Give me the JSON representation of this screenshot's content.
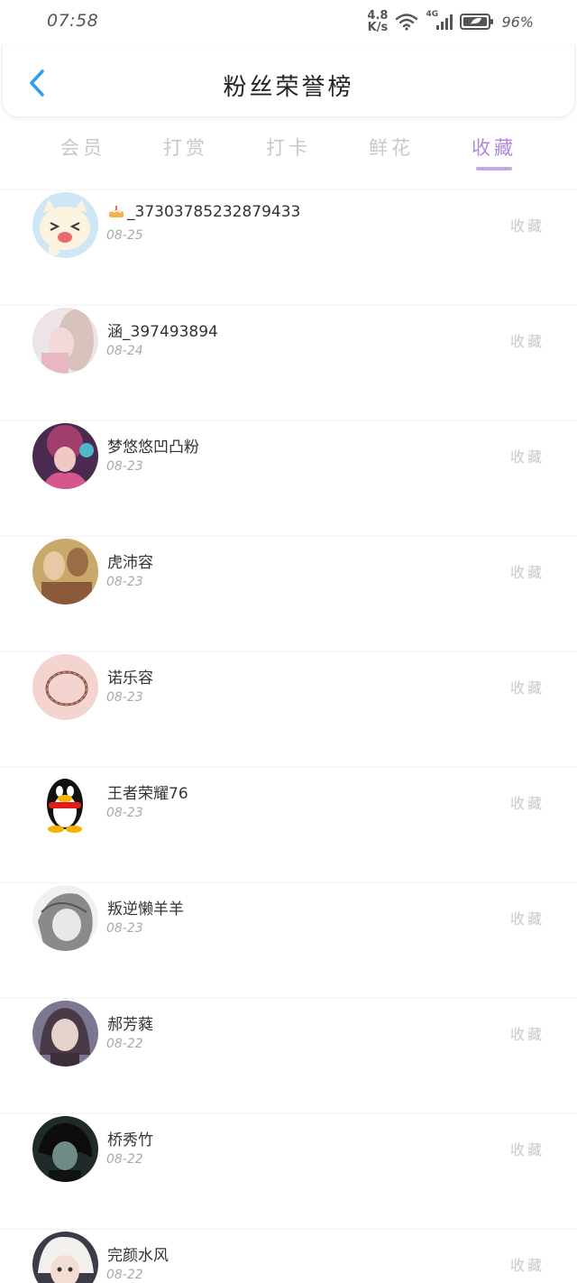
{
  "status": {
    "time": "07:58",
    "net_speed_value": "4.8",
    "net_speed_unit": "K/s",
    "network_type": "4G",
    "battery": "96%"
  },
  "header": {
    "title": "粉丝荣誉榜"
  },
  "tabs": [
    {
      "label": "会员",
      "active": false
    },
    {
      "label": "打赏",
      "active": false
    },
    {
      "label": "打卡",
      "active": false
    },
    {
      "label": "鲜花",
      "active": false
    },
    {
      "label": "收藏",
      "active": true
    }
  ],
  "colors": {
    "accent": "#b08ad8",
    "back_arrow": "#2ea0f0",
    "inactive_tab": "#c8c8c8",
    "muted_text": "#a9a9a9"
  },
  "fans": [
    {
      "name": "_37303785232879433",
      "name_prefix_icon": "cake-icon",
      "date": "08-25",
      "action": "收藏",
      "avatar": "cartoon-cat-avatar"
    },
    {
      "name": "涵_397493894",
      "date": "08-24",
      "action": "收藏",
      "avatar": "girl-photo-avatar"
    },
    {
      "name": "梦悠悠凹凸粉",
      "date": "08-23",
      "action": "收藏",
      "avatar": "anime-witch-avatar"
    },
    {
      "name": "虎沛容",
      "date": "08-23",
      "action": "收藏",
      "avatar": "couple-illustration-avatar"
    },
    {
      "name": "诺乐容",
      "date": "08-23",
      "action": "收藏",
      "avatar": "bracelet-avatar"
    },
    {
      "name": "王者荣耀76",
      "date": "08-23",
      "action": "收藏",
      "avatar": "qq-penguin-avatar"
    },
    {
      "name": "叛逆懒羊羊",
      "date": "08-23",
      "action": "收藏",
      "avatar": "sketch-girl-avatar"
    },
    {
      "name": "郝芳蕤",
      "date": "08-22",
      "action": "收藏",
      "avatar": "painted-girl-avatar"
    },
    {
      "name": "桥秀竹",
      "date": "08-22",
      "action": "收藏",
      "avatar": "dark-anime-avatar"
    },
    {
      "name": "完颜水风",
      "date": "08-22",
      "action": "收藏",
      "avatar": "child-hat-avatar"
    }
  ]
}
